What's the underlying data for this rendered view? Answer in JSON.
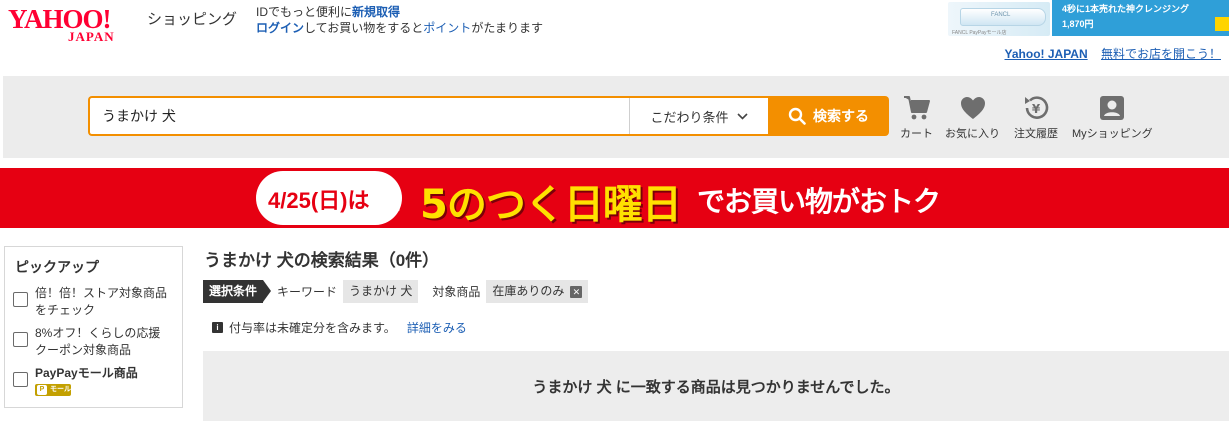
{
  "header": {
    "logo_text": "YAHOO!",
    "logo_sub": "JAPAN",
    "shopping_label": "ショッピング",
    "notice_line1_pre": "IDでもっと便利に",
    "notice_line1_link": "新規取得",
    "notice_line2_link1": "ログイン",
    "notice_line2_mid": "してお買い物をすると",
    "notice_line2_link2": "ポイント",
    "notice_line2_post": "がたまります",
    "ad_title": "4秒に1本売れた神クレンジング",
    "ad_price": "1,870円",
    "ad_brand": "FANCL",
    "ad_tiny": "FANCL PayPayモール店",
    "yahoo_japan_link": "Yahoo! JAPAN",
    "open_store_link": "無料でお店を開こう！"
  },
  "search": {
    "query": "うまかけ 犬",
    "kodawari_label": "こだわり条件",
    "button_label": "検索する"
  },
  "nav_icons": [
    {
      "label": "カート",
      "icon": "cart-icon"
    },
    {
      "label": "お気に入り",
      "icon": "heart-icon"
    },
    {
      "label": "注文履歴",
      "icon": "order-history-icon"
    },
    {
      "label": "Myショッピング",
      "icon": "account-icon"
    }
  ],
  "banner": {
    "date_text": "4/25(日)は",
    "main_text": "5のつく日曜日",
    "sub_text": "でお買い物がおトク",
    "bg_color": "#e60012",
    "accent_color": "#ffe100"
  },
  "sidebar": {
    "title": "ピックアップ",
    "items": [
      {
        "label": "倍！倍！ストア対象商品をチェック",
        "checked": false
      },
      {
        "label": "8%オフ！くらしの応援クーポン対象商品",
        "checked": false
      },
      {
        "label": "PayPayモール商品",
        "checked": false,
        "badge": "モール"
      }
    ]
  },
  "results": {
    "title": "うまかけ 犬の検索結果（0件）",
    "conditions_tag": "選択条件",
    "keyword_label": "キーワード",
    "keyword_value": "うまかけ 犬",
    "target_label": "対象商品",
    "target_value": "在庫ありのみ",
    "info_text": "付与率は未確定分を含みます。",
    "info_link": "詳細をみる",
    "no_result_message": "うまかけ 犬 に一致する商品は見つかりませんでした。"
  },
  "colors": {
    "brand_red": "#ff0033",
    "search_orange": "#f38f00",
    "link_blue": "#1d5fb4"
  }
}
